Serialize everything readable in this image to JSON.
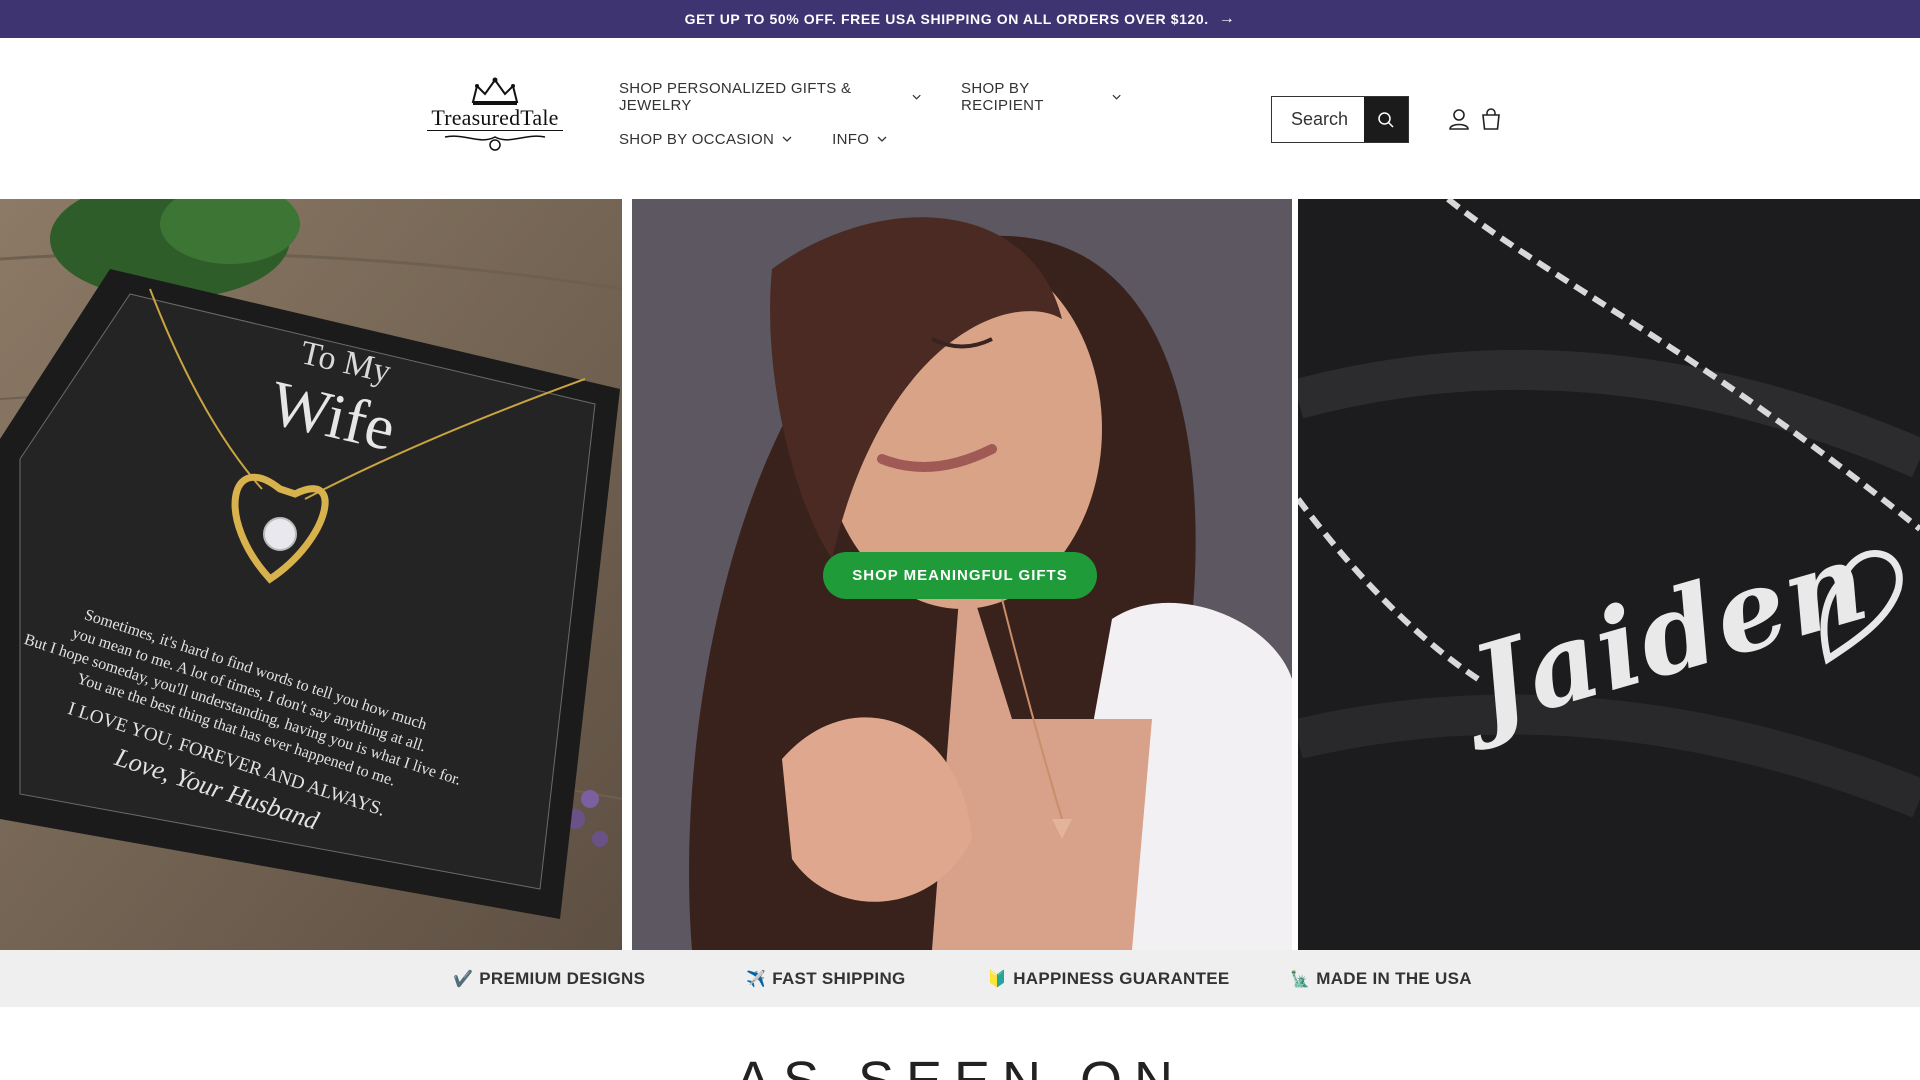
{
  "announcement": {
    "text": "GET UP TO 50% OFF. FREE USA SHIPPING ON ALL ORDERS OVER $120.",
    "arrow": "→",
    "bg": "#3d3471"
  },
  "logo": {
    "text": "TreasuredTale"
  },
  "nav": {
    "items": [
      {
        "label": "SHOP PERSONALIZED GIFTS & JEWELRY"
      },
      {
        "label": "SHOP BY RECIPIENT"
      },
      {
        "label": "SHOP BY OCCASION"
      },
      {
        "label": "INFO"
      }
    ]
  },
  "search": {
    "placeholder": "Search"
  },
  "header_icons": [
    "account-icon",
    "cart-icon"
  ],
  "hero": {
    "cta_label": "SHOP MEANINGFUL GIFTS",
    "cta_color": "#1f9b3a",
    "left_card": {
      "line1": "To My",
      "line2": "Wife",
      "message": [
        "Sometimes, it's hard to find words to tell you how much",
        "you mean to me. A lot of times, I don't say anything at all.",
        "But I hope someday, you'll understanding, having you is what I live for.",
        "You are the best thing that has ever happened to me."
      ],
      "closing1": "I LOVE YOU, FOREVER AND ALWAYS.",
      "closing2": "Love, Your Husband"
    },
    "right_name": "Jaiden"
  },
  "features": [
    {
      "icon": "✔️",
      "label": "PREMIUM DESIGNS"
    },
    {
      "icon": "✈️",
      "label": "FAST SHIPPING"
    },
    {
      "icon": "🔰",
      "label": "HAPPINESS GUARANTEE"
    },
    {
      "icon": "🗽",
      "label": "MADE IN THE USA"
    }
  ],
  "seen_on": {
    "title": "AS SEEN ON"
  }
}
